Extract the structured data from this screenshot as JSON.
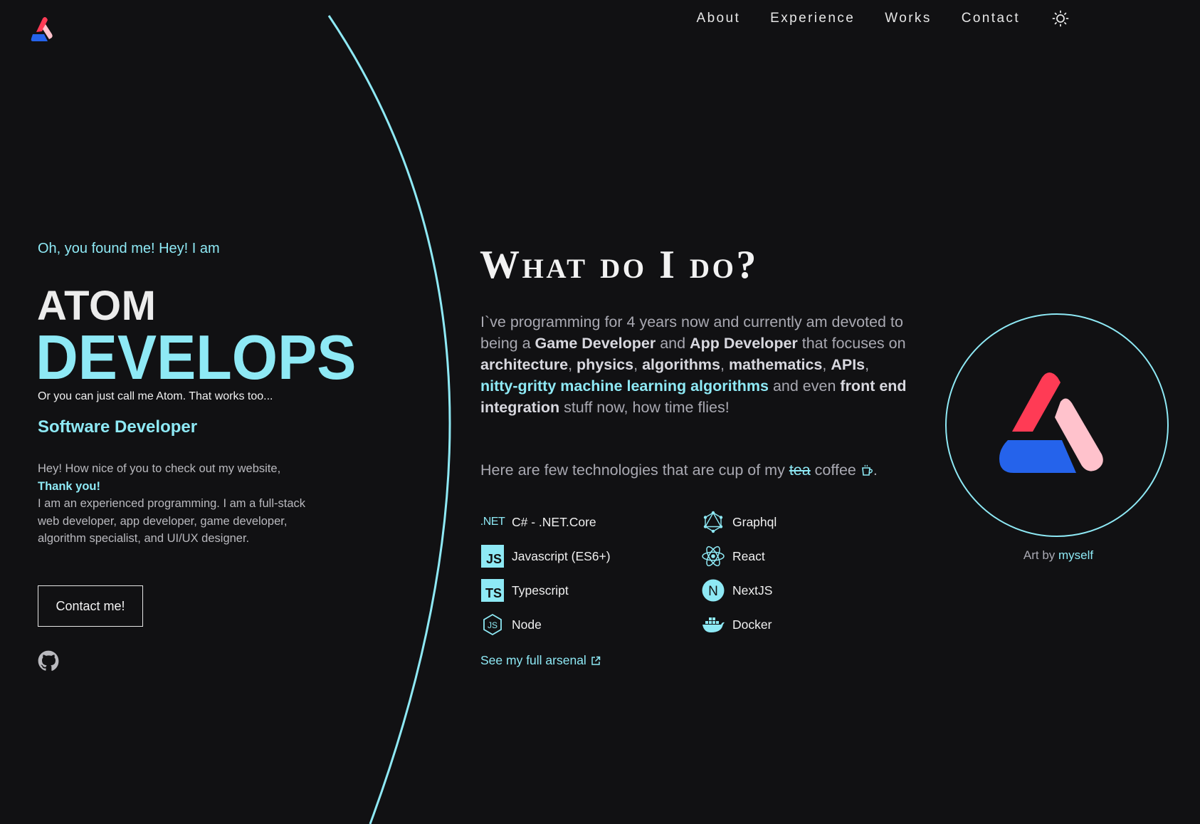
{
  "nav": {
    "items": [
      "About",
      "Experience",
      "Works",
      "Contact"
    ]
  },
  "hero": {
    "intro": "Oh, you found me! Hey! I am",
    "name": "ATOM",
    "tagline": "DEVELOPS",
    "call_me": "Or you can just call me Atom. That works too...",
    "role": "Software Developer",
    "bio_lead": "Hey! How nice of you to check out my website,",
    "bio_thanks": "Thank you!",
    "bio_body": "I am an experienced programming. I am a full-stack web developer, app developer, game developer, algorithm specialist, and UI/UX designer.",
    "contact_button": "Contact me!"
  },
  "about": {
    "heading": "What do I do?",
    "p1": "I`ve programming for 4 years now and currently am devoted to being a ",
    "game_dev": "Game Developer",
    "and1": " and ",
    "app_dev": "App Developer",
    "p2": " that focuses on ",
    "architecture": "architecture",
    "comma1": ", ",
    "physics": "physics",
    "comma2": ", ",
    "algorithms": "algorithms",
    "comma3": ", ",
    "mathematics": "mathematics",
    "comma4": ", ",
    "apis": "APIs",
    "comma5": ", ",
    "ml": "nitty-gritty machine learning algorithms",
    "p3": " and even ",
    "frontend": "front end integration",
    "p4": " stuff now, how time flies!",
    "cup_pre": "Here are few technologies that are cup of my ",
    "cup_strike": "tea",
    "cup_post": " coffee",
    "cup_end": ".",
    "tech_left": [
      {
        "label": "C# - .NET.Core",
        "icon": "dotnet-icon",
        "badge": ".NET"
      },
      {
        "label": "Javascript (ES6+)",
        "icon": "javascript-icon",
        "badge": "JS"
      },
      {
        "label": "Typescript",
        "icon": "typescript-icon",
        "badge": "TS"
      },
      {
        "label": "Node",
        "icon": "node-icon"
      }
    ],
    "tech_right": [
      {
        "label": "Graphql",
        "icon": "graphql-icon"
      },
      {
        "label": "React",
        "icon": "react-icon"
      },
      {
        "label": "NextJS",
        "icon": "nextjs-icon",
        "badge": "N"
      },
      {
        "label": "Docker",
        "icon": "docker-icon"
      }
    ],
    "arsenal_link": "See my full arsenal"
  },
  "art": {
    "prefix": "Art by ",
    "link": "myself"
  },
  "colors": {
    "background": "#111113",
    "accent": "#8ee9f5",
    "logo_red": "#ff3b55",
    "logo_pink": "#ffc2cc",
    "logo_blue": "#2563eb"
  }
}
